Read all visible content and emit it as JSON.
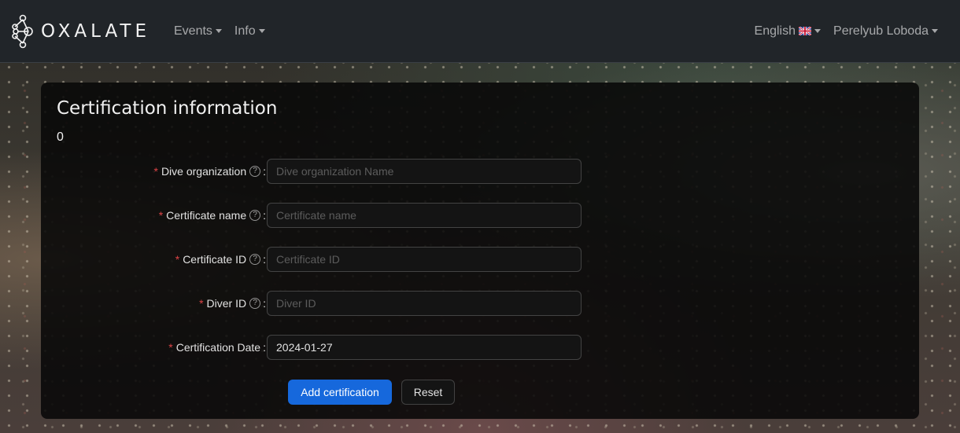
{
  "brand": {
    "name": "OXALATE",
    "logo_icon": "molecule-logo-icon"
  },
  "nav": {
    "left": [
      {
        "label": "Events"
      },
      {
        "label": "Info"
      }
    ],
    "language": {
      "label": "English",
      "flag_icon": "uk-flag-icon"
    },
    "user": {
      "label": "Perelyub Loboda"
    }
  },
  "card": {
    "title": "Certification information",
    "count": "0"
  },
  "form": {
    "fields": [
      {
        "label": "Dive organization",
        "placeholder": "Dive organization Name",
        "value": "",
        "required": true,
        "help": true
      },
      {
        "label": "Certificate name",
        "placeholder": "Certificate name",
        "value": "",
        "required": true,
        "help": true
      },
      {
        "label": "Certificate ID",
        "placeholder": "Certificate ID",
        "value": "",
        "required": true,
        "help": true
      },
      {
        "label": "Diver ID",
        "placeholder": "Diver ID",
        "value": "",
        "required": true,
        "help": true
      },
      {
        "label": "Certification Date",
        "placeholder": "",
        "value": "2024-01-27",
        "required": true,
        "help": false
      }
    ],
    "required_mark": "*",
    "help_glyph": "?",
    "colon": ":",
    "submit_label": "Add certification",
    "reset_label": "Reset"
  },
  "colors": {
    "navbar": "#212529",
    "primary": "#1668dc",
    "required": "#dc4446"
  }
}
